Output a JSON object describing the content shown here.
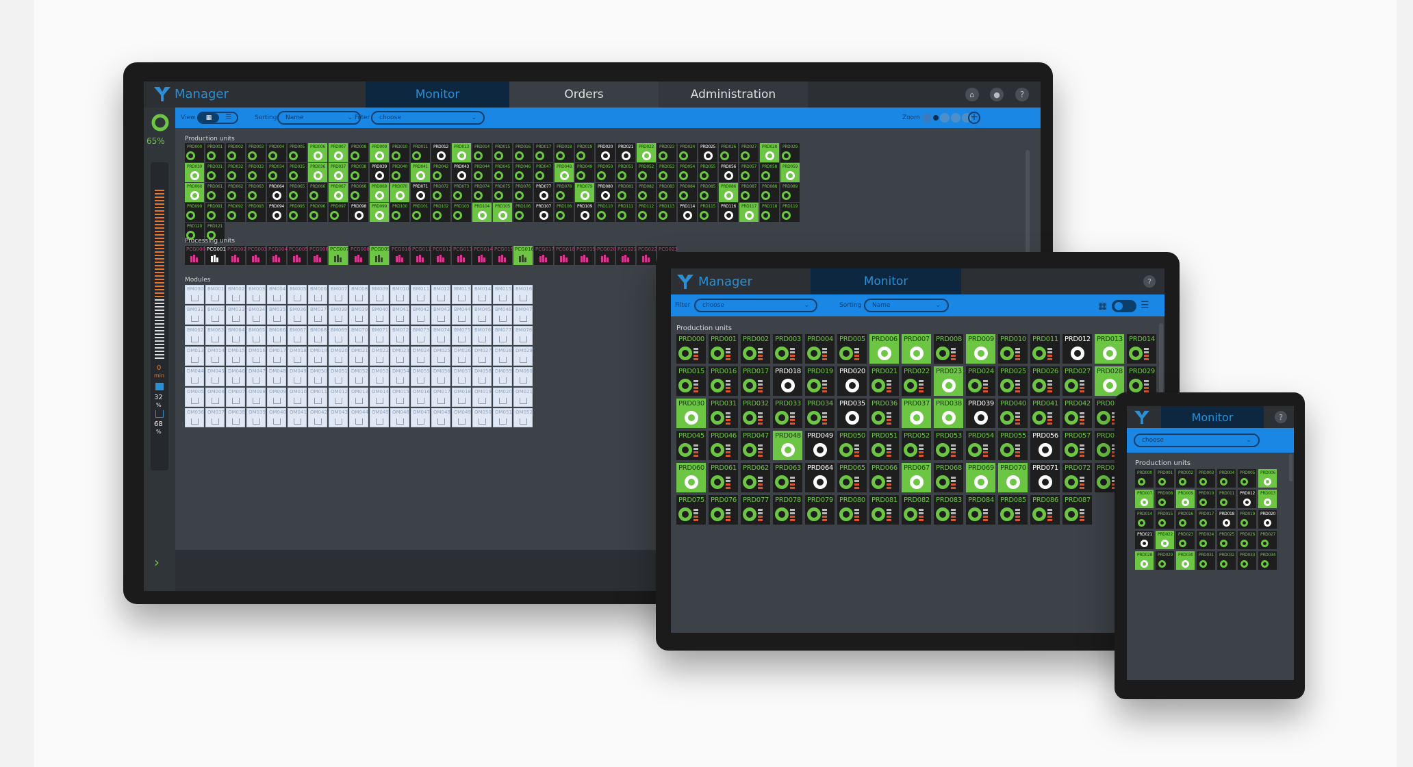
{
  "desktop": {
    "app_title": "Manager",
    "tabs": [
      "Monitor",
      "Orders",
      "Administration"
    ],
    "gauge_percent": "65%",
    "view_label": "View",
    "sorting_label": "Sorting",
    "sorting_value": "Name",
    "filter_label": "Filter",
    "filter_value": "choose",
    "zoom_label": "Zoom",
    "section_production": "Production units",
    "section_processing": "Processing units",
    "section_modules": "Modules",
    "side_min_value": "0",
    "side_min_unit": "min",
    "side_stat1_value": "32",
    "side_stat1_unit": "%",
    "side_stat2_value": "68",
    "side_stat2_unit": "%"
  },
  "tablet": {
    "app_title": "Manager",
    "tab": "Monitor",
    "filter_label": "Filter",
    "filter_value": "choose",
    "sorting_label": "Sorting",
    "sorting_value": "Name",
    "section_production": "Production units"
  },
  "phone": {
    "tab": "Monitor",
    "filter_value": "choose",
    "section_production": "Production units"
  },
  "units": {
    "desktop_count": 122,
    "tablet_count": 88,
    "phone_count": 35,
    "desktop_green": [
      6,
      7,
      9,
      13,
      22,
      28,
      30,
      36,
      37,
      41,
      48,
      59,
      60,
      67,
      69,
      70,
      79,
      86,
      99,
      104,
      105,
      117
    ],
    "desktop_white": [
      12,
      20,
      21,
      25,
      39,
      43,
      56,
      64,
      71,
      77,
      80,
      94,
      98,
      107,
      109,
      114,
      116
    ],
    "tablet_green": [
      6,
      7,
      9,
      13,
      23,
      28,
      30,
      37,
      38,
      48,
      59,
      60,
      67,
      69,
      70
    ],
    "tablet_white": [
      12,
      18,
      20,
      35,
      39,
      49,
      56,
      64,
      71
    ],
    "phone_green": [
      6,
      7,
      9,
      13,
      22,
      28,
      30
    ],
    "phone_white": [
      12,
      18,
      20,
      21
    ]
  },
  "processing": {
    "count": 24,
    "green": [
      7,
      9,
      16
    ],
    "white": [
      1
    ]
  },
  "modules": {
    "rows": [
      {
        "prefix": "BM",
        "start": 0,
        "count": 17
      },
      {
        "prefix": "BM",
        "start": 31,
        "count": 17
      },
      {
        "prefix": "BM",
        "start": 62,
        "count": 17
      },
      {
        "prefix": "DM",
        "start": 13,
        "count": 17
      },
      {
        "prefix": "DM",
        "start": 44,
        "count": 17
      },
      {
        "prefix": "OM",
        "start": 5,
        "count": 17
      },
      {
        "prefix": "OM",
        "start": 36,
        "count": 17
      }
    ]
  },
  "colors": {
    "accent_blue": "#1a87e5",
    "status_green": "#6cc644",
    "processing_magenta": "#d13a8f",
    "bar_orange": "#d9552c"
  }
}
